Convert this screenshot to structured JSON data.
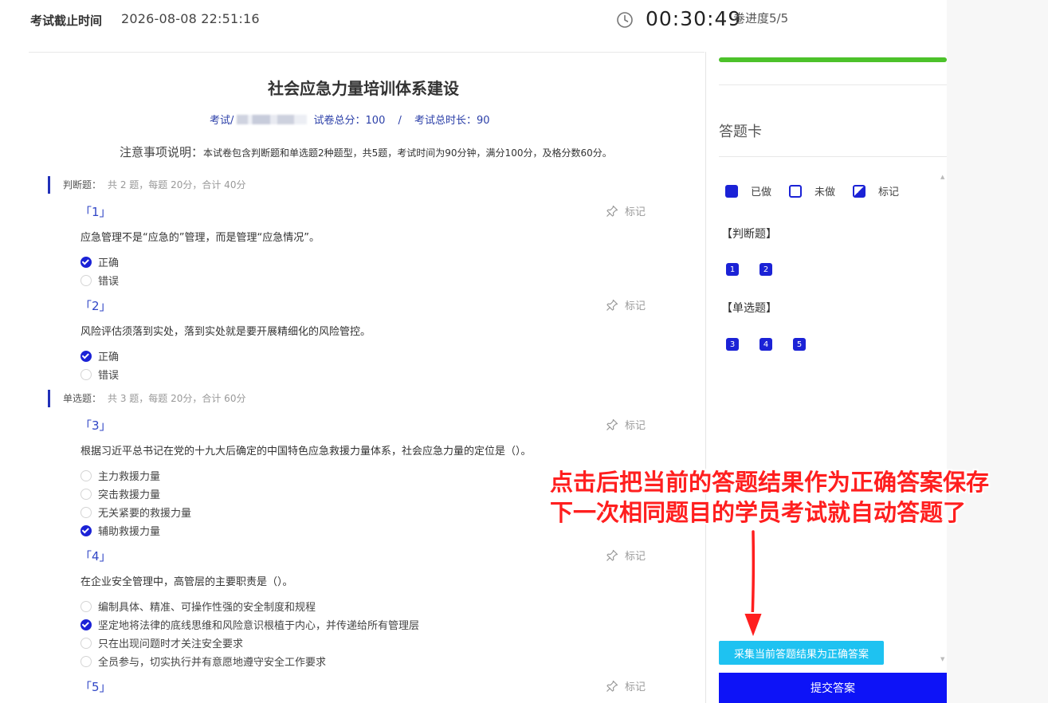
{
  "header": {
    "deadline_label": "考试截止时间",
    "deadline_value": "2026-08-08 22:51:16",
    "timer": "00:30:49",
    "progress_text": "卷进度5/5"
  },
  "paper": {
    "title": "社会应急力量培训体系建设",
    "meta_exam_prefix": "考试/",
    "meta_total_score": "试卷总分：100",
    "meta_separator": "/",
    "meta_duration": "考试总时长：90",
    "notice_lead": "注意事项说明：",
    "notice_text": "本试卷包含判断题和单选题2种题型，共5题，考试时间为90分钟，满分100分，及格分数60分。"
  },
  "sections": [
    {
      "name": "判断题：",
      "meta": "共 2 题，每题 20分，合计 40分"
    },
    {
      "name": "单选题：",
      "meta": "共 3 题，每题 20分，合计 60分"
    }
  ],
  "mark_label": "标记",
  "questions": [
    {
      "num": "「1」",
      "text": "应急管理不是“应急的”管理，而是管理“应急情况”。",
      "options": [
        {
          "text": "正确",
          "checked": true
        },
        {
          "text": "错误",
          "checked": false
        }
      ]
    },
    {
      "num": "「2」",
      "text": "风险评估须落到实处，落到实处就是要开展精细化的风险管控。",
      "options": [
        {
          "text": "正确",
          "checked": true
        },
        {
          "text": "错误",
          "checked": false
        }
      ]
    },
    {
      "num": "「3」",
      "text": "根据习近平总书记在党的十九大后确定的中国特色应急救援力量体系，社会应急力量的定位是（）。",
      "options": [
        {
          "text": "主力救援力量",
          "checked": false
        },
        {
          "text": "突击救援力量",
          "checked": false
        },
        {
          "text": "无关紧要的救援力量",
          "checked": false
        },
        {
          "text": "辅助救援力量",
          "checked": true
        }
      ]
    },
    {
      "num": "「4」",
      "text": "在企业安全管理中，高管层的主要职责是（）。",
      "options": [
        {
          "text": "编制具体、精准、可操作性强的安全制度和规程",
          "checked": false
        },
        {
          "text": "坚定地将法律的底线思维和风险意识根植于内心，并传递给所有管理层",
          "checked": true
        },
        {
          "text": "只在出现问题时才关注安全要求",
          "checked": false
        },
        {
          "text": "全员参与，切实执行并有意愿地遵守安全工作要求",
          "checked": false
        }
      ]
    },
    {
      "num": "「5」",
      "text": "",
      "options": []
    }
  ],
  "answer_card": {
    "progress_fraction": 1.0,
    "progress_color": "#4cc22a",
    "title": "答题卡",
    "legend": {
      "done": "已做",
      "todo": "未做",
      "marked": "标记"
    },
    "groups": [
      {
        "title": "【判断题】",
        "items": [
          "1",
          "2"
        ]
      },
      {
        "title": "【单选题】",
        "items": [
          "3",
          "4",
          "5"
        ]
      }
    ],
    "collect_button": "采集当前答题结果为正确答案",
    "submit_button": "提交答案"
  },
  "annotation": {
    "line1": "点击后把当前的答题结果作为正确答案保存",
    "line2": "下一次相同题目的学员考试就自动答题了",
    "color": "#ff1f1f"
  },
  "colors": {
    "accent": "#1b22d6",
    "submit": "#0d13f7",
    "collect": "#1ec2f1"
  }
}
